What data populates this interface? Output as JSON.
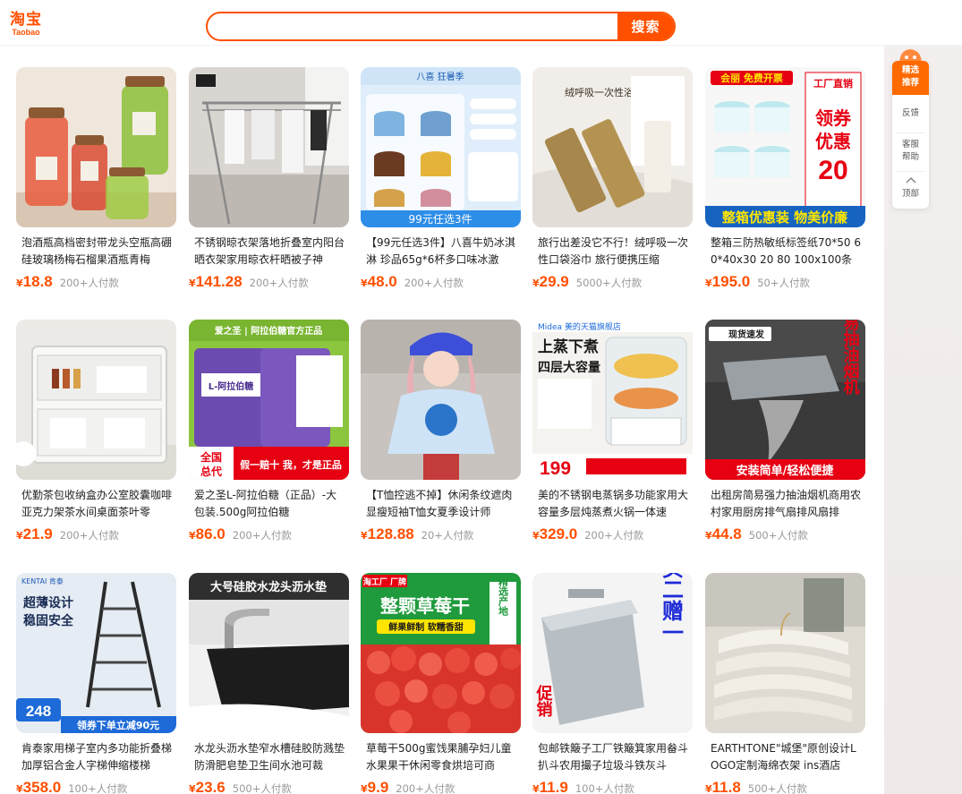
{
  "header": {
    "logo_cn": "淘宝",
    "logo_en": "Taobao",
    "search_placeholder": "",
    "search_button": "搜索"
  },
  "side_toolbar": {
    "items": [
      {
        "label": "精选推荐",
        "line1": "精选",
        "line2": "推荐"
      },
      {
        "label": "反馈",
        "line1": "反馈",
        "line2": ""
      },
      {
        "label": "客服帮助",
        "line1": "客服",
        "line2": "帮助"
      },
      {
        "label": "顶部",
        "line1": "顶部",
        "line2": ""
      }
    ]
  },
  "products": [
    {
      "title": "泡酒瓶高档密封带龙头空瓶高硼硅玻璃杨梅石榴果酒瓶青梅",
      "price": "18.8",
      "sales": "200+人付款",
      "image": "glass-jars"
    },
    {
      "title": "不锈钢晾衣架落地折叠室内阳台晒衣架家用晾衣杆晒被子神",
      "price": "141.28",
      "sales": "200+人付款",
      "image": "drying-rack"
    },
    {
      "title": "【99元任选3件】八喜牛奶冰淇淋 珍品65g*6杯多口味冰激",
      "price": "48.0",
      "sales": "200+人付款",
      "image": "ice-cream"
    },
    {
      "title": "旅行出差没它不行！绒呼吸一次性口袋浴巾 旅行便携压缩",
      "price": "29.9",
      "sales": "5000+人付款",
      "image": "bath-towel"
    },
    {
      "title": "整箱三防热敏纸标签纸70*50 60*40x30 20 80 100x100条",
      "price": "195.0",
      "sales": "50+人付款",
      "image": "label-rolls"
    },
    {
      "title": "优勤茶包收纳盒办公室胶囊咖啡亚克力架茶水间桌面茶叶零",
      "price": "21.9",
      "sales": "200+人付款",
      "image": "tea-box"
    },
    {
      "title": "爱之圣L-阿拉伯糖（正品）-大包装.500g阿拉伯糖",
      "price": "86.0",
      "sales": "200+人付款",
      "image": "sugar-bag"
    },
    {
      "title": "【T恤控逃不掉】休闲条纹遮肉显瘦短袖T恤女夏季设计师",
      "price": "128.88",
      "sales": "20+人付款",
      "image": "tshirt-girl"
    },
    {
      "title": "美的不锈钢电蒸锅多功能家用大容量多层炖蒸煮火锅一体速",
      "price": "329.0",
      "sales": "200+人付款",
      "image": "steamer"
    },
    {
      "title": "出租房简易强力抽油烟机商用农村家用厨房排气扇排风扇排",
      "price": "44.8",
      "sales": "500+人付款",
      "image": "range-hood"
    },
    {
      "title": "肯泰家用梯子室内多功能折叠梯加厚铝合金人字梯伸缩楼梯",
      "price": "358.0",
      "sales": "100+人付款",
      "image": "ladder"
    },
    {
      "title": "水龙头沥水垫窄水槽硅胶防溅垫防滑肥皂垫卫生间水池可裁",
      "price": "23.6",
      "sales": "500+人付款",
      "image": "faucet-mat"
    },
    {
      "title": "草莓干500g蜜饯果脯孕妇儿童水果果干休闲零食烘培可商",
      "price": "9.9",
      "sales": "200+人付款",
      "image": "dried-strawberry"
    },
    {
      "title": "包邮铁簸子工厂铁簸箕家用畚斗扒斗农用撮子垃圾斗铁灰斗",
      "price": "11.9",
      "sales": "100+人付款",
      "image": "dustpan"
    },
    {
      "title": "EARTHTONE\"城堡\"原创设计LOGO定制海绵衣架 ins酒店",
      "price": "11.8",
      "sales": "500+人付款",
      "image": "hangers"
    }
  ],
  "image_texts": {
    "ice_cream_top": "八喜  狂暑季",
    "ice_cream_bottom": "99元任选3件",
    "towel_brand": "绒呼吸一次性浴巾",
    "labels_promo": "会丽 免费开票",
    "labels_factory": "工厂直销",
    "labels_big1": "领券",
    "labels_big2": "优惠",
    "labels_num": "20",
    "labels_bottom": "整箱优惠装 物美价廉",
    "sugar_brand": "爱之圣 | 阿拉伯糖官方正品",
    "sugar_pack": "L-阿拉伯糖",
    "sugar_tag1": "全国",
    "sugar_tag2": "总代",
    "sugar_bottom": "假一赔十  我，才是正品",
    "steamer_brand": "Midea 美的天猫旗舰店",
    "steamer_title1": "上蒸下煮",
    "steamer_title2": "四层大容量",
    "steamer_price": "199",
    "hood_tag": "现货速发",
    "hood_side": "简易抽油烟机",
    "hood_bottom": "安装简单/轻松便捷",
    "ladder_brand": "KENTAI 肯泰",
    "ladder_title1": "超薄设计",
    "ladder_title2": "稳固安全",
    "ladder_price": "248",
    "ladder_coupon": "领券下单立减90元",
    "mat_title": "大号硅胶水龙头沥水垫",
    "berry_tag": "淘工厂 厂牌",
    "berry_title": "整颗草莓干",
    "berry_sub": "鲜果鲜制  软糯香甜",
    "berry_side": "精选产地",
    "dustpan_text1": "买二赠一",
    "dustpan_text2": "促销"
  },
  "colors": {
    "brand": "#ff5000",
    "price": "#ff5000",
    "sales": "#999999",
    "side_active": "#ff6a00"
  }
}
